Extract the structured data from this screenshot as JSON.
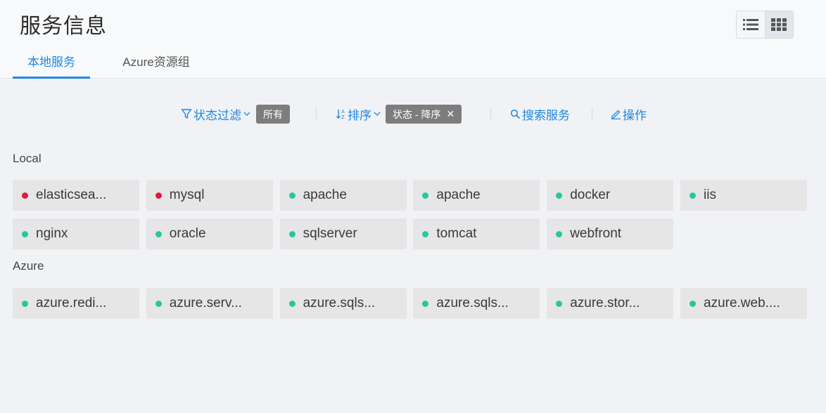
{
  "header": {
    "title": "服务信息",
    "view_modes": [
      "list-view",
      "grid-view"
    ],
    "active_view": "grid-view"
  },
  "tabs": [
    {
      "label": "本地服务",
      "active": true
    },
    {
      "label": "Azure资源组",
      "active": false
    }
  ],
  "filters": {
    "status_filter": {
      "label": "状态过滤",
      "icon": "filter-icon",
      "value": "所有"
    },
    "sort": {
      "label": "排序",
      "icon": "sort-icon",
      "value": "状态 - 降序"
    },
    "search": {
      "label": "搜索服务",
      "icon": "search-icon"
    },
    "action": {
      "label": "操作",
      "icon": "edit-icon"
    }
  },
  "colors": {
    "accent": "#1e88e5",
    "status_up": "#26c6a0",
    "status_down": "#e5173f"
  },
  "groups": [
    {
      "name": "Local",
      "services": [
        {
          "name": "elasticsea...",
          "status": "down"
        },
        {
          "name": "mysql",
          "status": "down"
        },
        {
          "name": "apache",
          "status": "up"
        },
        {
          "name": "apache",
          "status": "up"
        },
        {
          "name": "docker",
          "status": "up"
        },
        {
          "name": "iis",
          "status": "up"
        },
        {
          "name": "nginx",
          "status": "up"
        },
        {
          "name": "oracle",
          "status": "up"
        },
        {
          "name": "sqlserver",
          "status": "up"
        },
        {
          "name": "tomcat",
          "status": "up"
        },
        {
          "name": "webfront",
          "status": "up"
        }
      ]
    },
    {
      "name": "Azure",
      "services": [
        {
          "name": "azure.redi...",
          "status": "up"
        },
        {
          "name": "azure.serv...",
          "status": "up"
        },
        {
          "name": "azure.sqls...",
          "status": "up"
        },
        {
          "name": "azure.sqls...",
          "status": "up"
        },
        {
          "name": "azure.stor...",
          "status": "up"
        },
        {
          "name": "azure.web....",
          "status": "up"
        }
      ]
    }
  ]
}
